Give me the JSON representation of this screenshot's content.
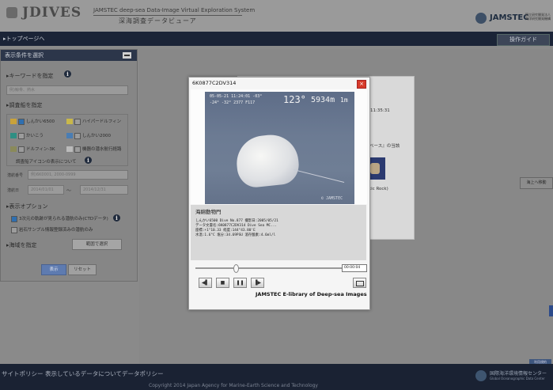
{
  "header": {
    "logo_text": "JDIVES",
    "system_name_en": "JAMSTEC deep-sea Data-Image Virtual Exploration System",
    "system_name_jp": "深海調査データビューア",
    "org_logo_text": "JAMSTEC",
    "org_logo_sub": "国立研究開発法人 海洋研究開発機構"
  },
  "nav": {
    "top_page_link": "▸トップページへ",
    "guide_button": "操作ガイド"
  },
  "sidebar": {
    "title": "表示条件を選択",
    "keyword_label": "▸キーワードを指定",
    "keyword_placeholder": "例)鯨骨、熱水",
    "vessel_label": "▸調査船を指定",
    "vessels": [
      {
        "name": "しんかい6500",
        "color": "#c9a23a",
        "checked": true
      },
      {
        "name": "ハイパードルフィン",
        "color": "#c9b84a",
        "checked": false
      },
      {
        "name": "かいこう",
        "color": "#2f8f83",
        "checked": false
      },
      {
        "name": "しんかい2000",
        "color": "#4a7db3",
        "checked": false
      },
      {
        "name": "ドルフィン-3K",
        "color": "#8a8a5a",
        "checked": false
      },
      {
        "name": "機器の潜水航行経路",
        "color": "#bbbbbb",
        "checked": false
      }
    ],
    "vessel_icon_note": "調査船アイコンの表示について",
    "dive_number_label": "潜航番号",
    "dive_number_placeholder": "例)6K0001, 2000-0999",
    "dive_date_label": "潜航日",
    "date_from": "2014/01/01",
    "date_sep": "〜",
    "date_to": "2014/12/31",
    "display_options_label": "▸表示オプション",
    "options": [
      {
        "label": "3次元の軌跡が見られる潜航のみ(CTDデータ)",
        "checked": true
      },
      {
        "label": "岩石サンプル情報登録済みの潜航のみ",
        "checked": false
      }
    ],
    "area_label": "▸海域を指定",
    "map_select_button": "範囲で選択",
    "show_button": "表示",
    "reset_button": "リセット"
  },
  "background_card": {
    "time_text": "11:35:31",
    "db_text": "ベース』の当該",
    "rock_text": "tic Rock)"
  },
  "side_tab": "海上へ移動",
  "credit_tag": "利用規約",
  "modal": {
    "title": "6K0877C2DV314",
    "close": "×",
    "osd_line1": "05-05-21  11:24:01  -03°",
    "osd_line2": "-24°  -32°  2377  F117",
    "osd_heading": "123°",
    "osd_depth": "5934m",
    "osd_scale": "1m",
    "osd_watermark": "© JAMSTEC",
    "caption_title": "海綿動物門",
    "caption_lines": [
      "しんかい6500 Dive No.877 撮影日:2005/05/21",
      "データ文書名:6K0877C2DV314 Dive Sea MC...",
      "座標:+1°10.33 経度:144°43.80'E",
      "水温:1.6°C 塩分:34.69PSU 溶存酸素:4.6ml/l"
    ],
    "timecode": "00:00:04",
    "controls": {
      "rewind": "◀▌",
      "stop": "■",
      "pause": "❚❚",
      "forward": "▐▶"
    },
    "library_label": "JAMSTEC E-library of Deep-sea Images"
  },
  "footer": {
    "links": [
      "サイトポリシー",
      "表示しているデータについて",
      "データポリシー"
    ],
    "copyright": "Copyright 2014 Japan Agency for Marine-Earth Science and Technology",
    "org_jp": "国際海洋環境情報センター",
    "org_en": "Global Oceanographic Data Center"
  }
}
